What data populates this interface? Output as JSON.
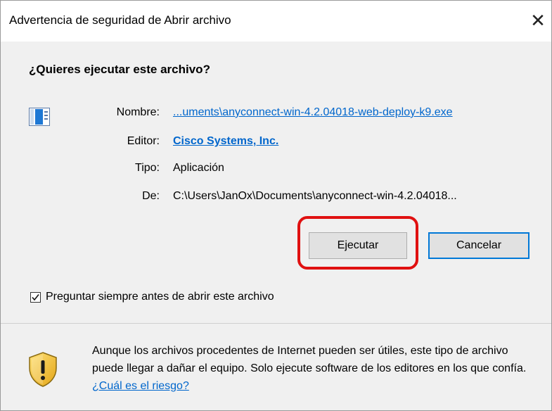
{
  "window": {
    "title": "Advertencia de seguridad de Abrir archivo",
    "close_glyph": "✕"
  },
  "question": "¿Quieres ejecutar este archivo?",
  "file_icon": "application-window-icon",
  "details": {
    "name_label": "Nombre:",
    "name_value": "...uments\\anyconnect-win-4.2.04018-web-deploy-k9.exe",
    "publisher_label": "Editor:",
    "publisher_value": "Cisco Systems, Inc.",
    "type_label": "Tipo:",
    "type_value": "Aplicación",
    "from_label": "De:",
    "from_value": "C:\\Users\\JanOx\\Documents\\anyconnect-win-4.2.04018..."
  },
  "buttons": {
    "run": "Ejecutar",
    "cancel": "Cancelar"
  },
  "checkbox": {
    "label": "Preguntar siempre antes de abrir este archivo",
    "checked": true,
    "check_glyph": "✓"
  },
  "warning": {
    "icon": "shield-warning-icon",
    "text": "Aunque los archivos procedentes de Internet pueden ser útiles, este tipo de archivo puede llegar a dañar el equipo. Solo ejecute software de los editores en los que confía.",
    "risk_link": "¿Cuál es el riesgo?"
  },
  "colors": {
    "link": "#0066cc",
    "highlight": "#e01010",
    "default_button_border": "#0078d7"
  }
}
